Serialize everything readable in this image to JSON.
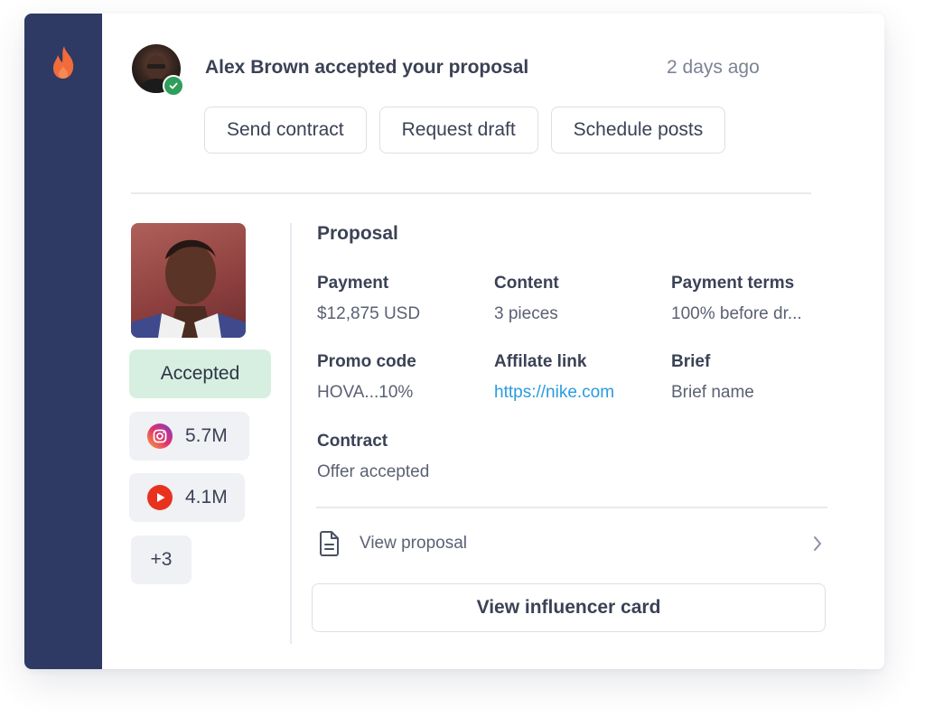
{
  "notification": {
    "headline": "Alex Brown accepted your proposal",
    "timestamp": "2 days ago",
    "actions": [
      {
        "label": "Send contract"
      },
      {
        "label": "Request draft"
      },
      {
        "label": "Schedule posts"
      }
    ]
  },
  "influencer": {
    "status": "Accepted",
    "stats": [
      {
        "platform": "instagram-icon",
        "value": "5.7M"
      },
      {
        "platform": "youtube-icon",
        "value": "4.1M"
      }
    ],
    "more": "+3"
  },
  "proposal": {
    "title": "Proposal",
    "fields": [
      {
        "label": "Payment",
        "value": "$12,875 USD"
      },
      {
        "label": "Content",
        "value": "3 pieces"
      },
      {
        "label": "Payment terms",
        "value": "100% before dr..."
      },
      {
        "label": "Promo code",
        "value": "HOVA...10%"
      },
      {
        "label": "Affilate link",
        "value": "https://nike.com"
      },
      {
        "label": "Brief",
        "value": "Brief name"
      },
      {
        "label": "Contract",
        "value": "Offer accepted"
      }
    ],
    "view_proposal": "View proposal",
    "view_card": "View influencer card"
  },
  "colors": {
    "sidebar": "#2e3a63",
    "brand_flame": "#f26b3a",
    "accepted_bg": "#d7efe0",
    "link": "#2b9be0",
    "verified": "#2f9e5b"
  }
}
